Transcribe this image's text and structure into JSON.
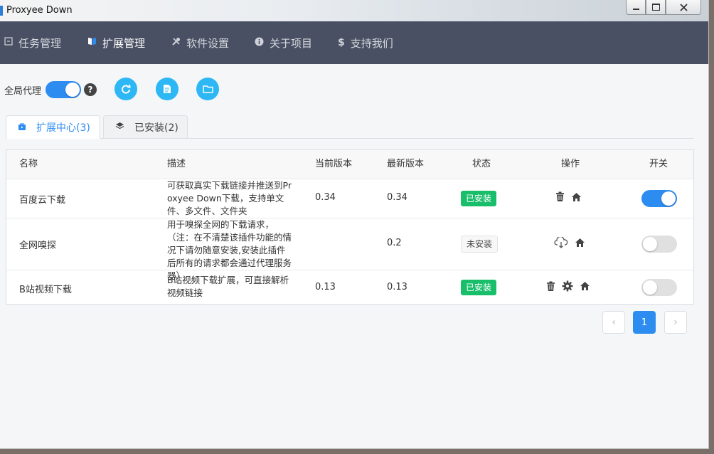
{
  "window": {
    "title": "Proxyee Down"
  },
  "nav": {
    "task": "任务管理",
    "extension": "扩展管理",
    "settings": "软件设置",
    "about": "关于项目",
    "support": "支持我们"
  },
  "toolbar": {
    "proxy_label": "全局代理",
    "proxy_on": true,
    "help": "?"
  },
  "tabs": {
    "center": "扩展中心(3)",
    "installed": "已安装(2)"
  },
  "table": {
    "headers": [
      "名称",
      "描述",
      "当前版本",
      "最新版本",
      "状态",
      "操作",
      "开关"
    ],
    "rows": [
      {
        "name": "百度云下载",
        "desc": "可获取真实下载链接并推送到Proxyee Down下载，支持单文件、多文件、文件夹",
        "current": "0.34",
        "latest": "0.34",
        "status": "已安装",
        "switch": true
      },
      {
        "name": "全网嗅探",
        "desc": "用于嗅探全网的下载请求，（注：在不清楚该插件功能的情况下请勿随意安装,安装此插件后所有的请求都会通过代理服务器）",
        "current": "",
        "latest": "0.2",
        "status": "未安装",
        "switch": false
      },
      {
        "name": "B站视频下载",
        "desc": "B站视频下载扩展，可直接解析视频链接",
        "current": "0.13",
        "latest": "0.13",
        "status": "已安装",
        "switch": false
      }
    ]
  },
  "pagination": {
    "current": "1",
    "prev": "‹",
    "next": "›"
  },
  "colors": {
    "nav_bg": "#4a5064",
    "primary": "#2d8cf0",
    "success": "#19be6b",
    "info": "#2db7f5"
  }
}
